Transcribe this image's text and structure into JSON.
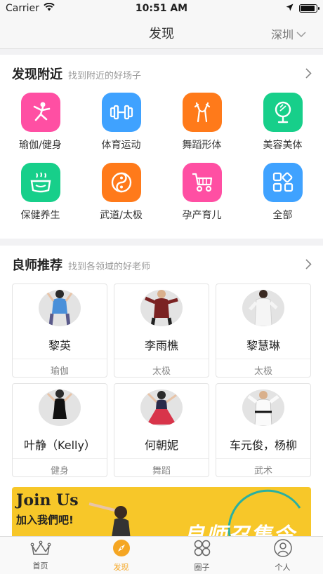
{
  "status": {
    "carrier": "Carrier",
    "time": "10:51 AM",
    "battery_level": 0.9
  },
  "nav": {
    "title": "发现",
    "city": "深圳"
  },
  "nearby": {
    "title": "发现附近",
    "subtitle": "找到附近的好场子",
    "categories": [
      {
        "label": "瑜伽/健身",
        "icon": "yoga-icon",
        "color": "#ff4fa3"
      },
      {
        "label": "体育运动",
        "icon": "dumbbell-icon",
        "color": "#3fa2ff"
      },
      {
        "label": "舞蹈形体",
        "icon": "dance-icon",
        "color": "#ff7a1a"
      },
      {
        "label": "美容美体",
        "icon": "mirror-icon",
        "color": "#17cf8a"
      },
      {
        "label": "保健养生",
        "icon": "health-pot-icon",
        "color": "#17cf8a"
      },
      {
        "label": "武道/太极",
        "icon": "taiji-icon",
        "color": "#ff7a1a"
      },
      {
        "label": "孕产育儿",
        "icon": "stroller-icon",
        "color": "#ff4fa3"
      },
      {
        "label": "全部",
        "icon": "all-grid-icon",
        "color": "#3fa2ff"
      }
    ]
  },
  "teachers": {
    "title": "良师推荐",
    "subtitle": "找到各领域的好老师",
    "items": [
      {
        "name": "黎英",
        "field": "瑜伽"
      },
      {
        "name": "李雨樵",
        "field": "太极"
      },
      {
        "name": "黎慧琳",
        "field": "太极"
      },
      {
        "name": "叶静（Kelly）",
        "field": "健身"
      },
      {
        "name": "何朝妮",
        "field": "舞蹈"
      },
      {
        "name": "车元俊，杨柳",
        "field": "武术"
      }
    ]
  },
  "banner": {
    "join": "Join Us",
    "join_cn": "加入我們吧!",
    "headline": "良师召集令"
  },
  "tabbar": {
    "tabs": [
      {
        "label": "首页",
        "icon": "crown-icon",
        "active": false
      },
      {
        "label": "发现",
        "icon": "compass-icon",
        "active": true
      },
      {
        "label": "圈子",
        "icon": "circles-icon",
        "active": false
      },
      {
        "label": "个人",
        "icon": "person-icon",
        "active": false
      }
    ],
    "accent": "#f5a623"
  }
}
